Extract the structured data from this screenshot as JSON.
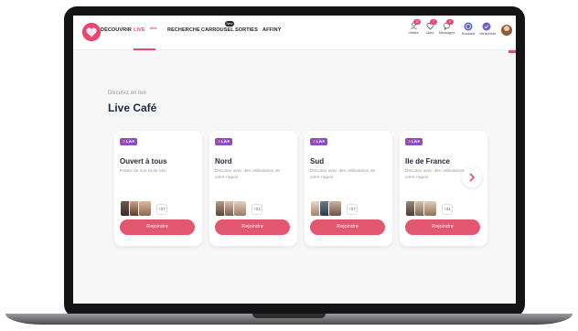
{
  "nav": {
    "links": [
      {
        "label": "DÉCOUVRIR"
      },
      {
        "label": "LIVE",
        "badge": "New"
      },
      {
        "label": "RECHERCHE"
      },
      {
        "label": "CARROUSEL",
        "badge": "New"
      },
      {
        "label": "SORTIES"
      },
      {
        "label": "AFFINY"
      }
    ],
    "icons": [
      {
        "label": "Visites",
        "count": "12"
      },
      {
        "label": "Likes",
        "count": "7"
      },
      {
        "label": "Messages",
        "count": "2"
      },
      {
        "label": "Boosted"
      },
      {
        "label": "Verisphere"
      }
    ]
  },
  "section": {
    "subtitle": "Discutez en live",
    "title": "Live Café"
  },
  "cards": [
    {
      "tag": "Live",
      "title": "Ouvert à tous",
      "desc": "Parlez de tout et de rien",
      "more": "+27",
      "button": "Rejoindre"
    },
    {
      "tag": "Live",
      "title": "Nord",
      "desc": "Discutez avec des célibataires de votre région",
      "more": "+24",
      "button": "Rejoindre"
    },
    {
      "tag": "Live",
      "title": "Sud",
      "desc": "Discutez avec des célibataires de votre région",
      "more": "+27",
      "button": "Rejoindre"
    },
    {
      "tag": "Live",
      "title": "Ile de France",
      "desc": "Discutez avec des célibataires de votre région",
      "more": "+21",
      "button": "Rejoindre"
    }
  ],
  "colors": {
    "accent": "#e3566f",
    "live_tag": "#8a4cc8",
    "title": "#1e2a3a"
  }
}
